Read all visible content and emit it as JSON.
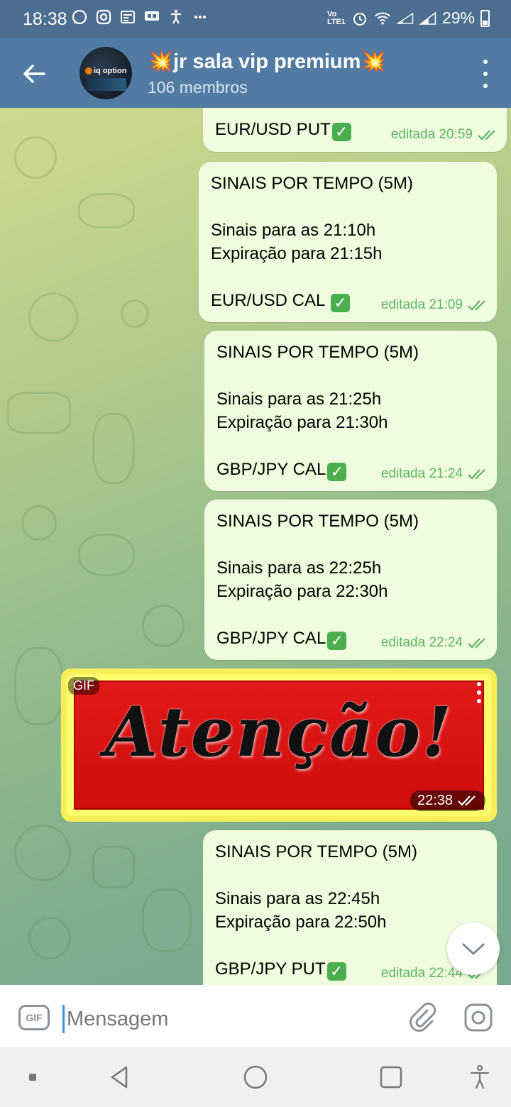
{
  "status_bar": {
    "time": "18:38",
    "network_label": "Vo LTE1",
    "battery": "29%"
  },
  "header": {
    "title": "💥jr sala vip premium💥",
    "members": "106 membros",
    "avatar_text": "iq option"
  },
  "messages": [
    {
      "lines": [],
      "pair": "EUR/USD PUT",
      "meta": "editada 20:59"
    },
    {
      "lines": [
        "SINAIS POR TEMPO (5M)",
        "",
        "Sinais para as 21:10h",
        "Expiração para 21:15h",
        ""
      ],
      "pair": "EUR/USD CAL ",
      "meta": "editada 21:09"
    },
    {
      "lines": [
        "SINAIS POR TEMPO (5M)",
        "",
        "Sinais para as 21:25h",
        "Expiração para 21:30h",
        ""
      ],
      "pair": "GBP/JPY CAL",
      "meta": "editada 21:24"
    },
    {
      "lines": [
        "SINAIS POR TEMPO (5M)",
        "",
        "Sinais para as 22:25h",
        "Expiração para 22:30h",
        ""
      ],
      "pair": "GBP/JPY CAL",
      "meta": "editada 22:24"
    },
    {
      "lines": [
        "SINAIS POR TEMPO (5M)",
        "",
        "Sinais para as 22:45h",
        "Expiração para 22:50h",
        ""
      ],
      "pair": "GBP/JPY PUT",
      "meta": "editada 22:44"
    }
  ],
  "gif": {
    "badge": "GIF",
    "text": "Atenção!",
    "time": "22:38"
  },
  "check_mark": "✓",
  "input": {
    "gif_button": "GIF",
    "placeholder": "Mensagem"
  },
  "colors": {
    "header": "#517ba2",
    "status_bar": "#4b6e91",
    "bubble": "#effdde",
    "meta_green": "#5fb366",
    "check_green": "#4cae4f"
  },
  "icons": [
    "back-arrow-icon",
    "more-vert-icon",
    "double-check-icon",
    "chevron-down-icon",
    "paperclip-icon",
    "camera-icon",
    "nav-back-icon",
    "nav-home-icon",
    "nav-recents-icon",
    "accessibility-icon"
  ]
}
